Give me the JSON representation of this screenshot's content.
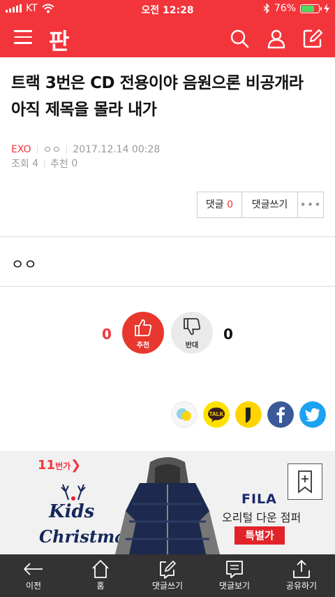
{
  "status_bar": {
    "carrier": "KT",
    "time": "오전 12:28",
    "battery_percent": "76%",
    "battery_level": 0.76
  },
  "header": {
    "logo": "판",
    "icons": [
      "menu-icon",
      "search-icon",
      "user-icon",
      "write-icon"
    ]
  },
  "post": {
    "title": "트랙 3번은 CD 전용이야 음원으론 비공개라 아직 제목을 몰라 내가",
    "category": "EXO",
    "author": "ㅇㅇ",
    "date": "2017.12.14 00:28",
    "views_label": "조회",
    "views": "4",
    "recommend_label": "추천",
    "recommend": "0",
    "body": "ㅇㅇ"
  },
  "comment_buttons": {
    "comments_label": "댓글",
    "comments_count": "0",
    "write_label": "댓글쓰기",
    "more_label": "•••"
  },
  "vote": {
    "up_count": "0",
    "up_label": "추천",
    "down_label": "반대",
    "down_count": "0"
  },
  "share": [
    "kakaostory-icon",
    "kakaotalk-icon",
    "kakaopage-icon",
    "facebook-icon",
    "twitter-icon"
  ],
  "ad": {
    "brand_11st": "11",
    "brand_11st_suffix": "번가",
    "kids": "Kids",
    "christmas": "Christmas",
    "fila": "FILA",
    "desc": "오리털 다운 점퍼",
    "sale": "특별가"
  },
  "bottom_nav": [
    {
      "label": "이전",
      "icon": "back-arrow-icon"
    },
    {
      "label": "홈",
      "icon": "home-icon"
    },
    {
      "label": "댓글쓰기",
      "icon": "write-comment-icon"
    },
    {
      "label": "댓글보기",
      "icon": "view-comment-icon"
    },
    {
      "label": "공유하기",
      "icon": "share-icon"
    }
  ],
  "colors": {
    "brand": "#f2353b",
    "nav_bg": "#333333",
    "facebook": "#3b5998",
    "twitter": "#1da1f2",
    "kakao": "#ffe100"
  }
}
